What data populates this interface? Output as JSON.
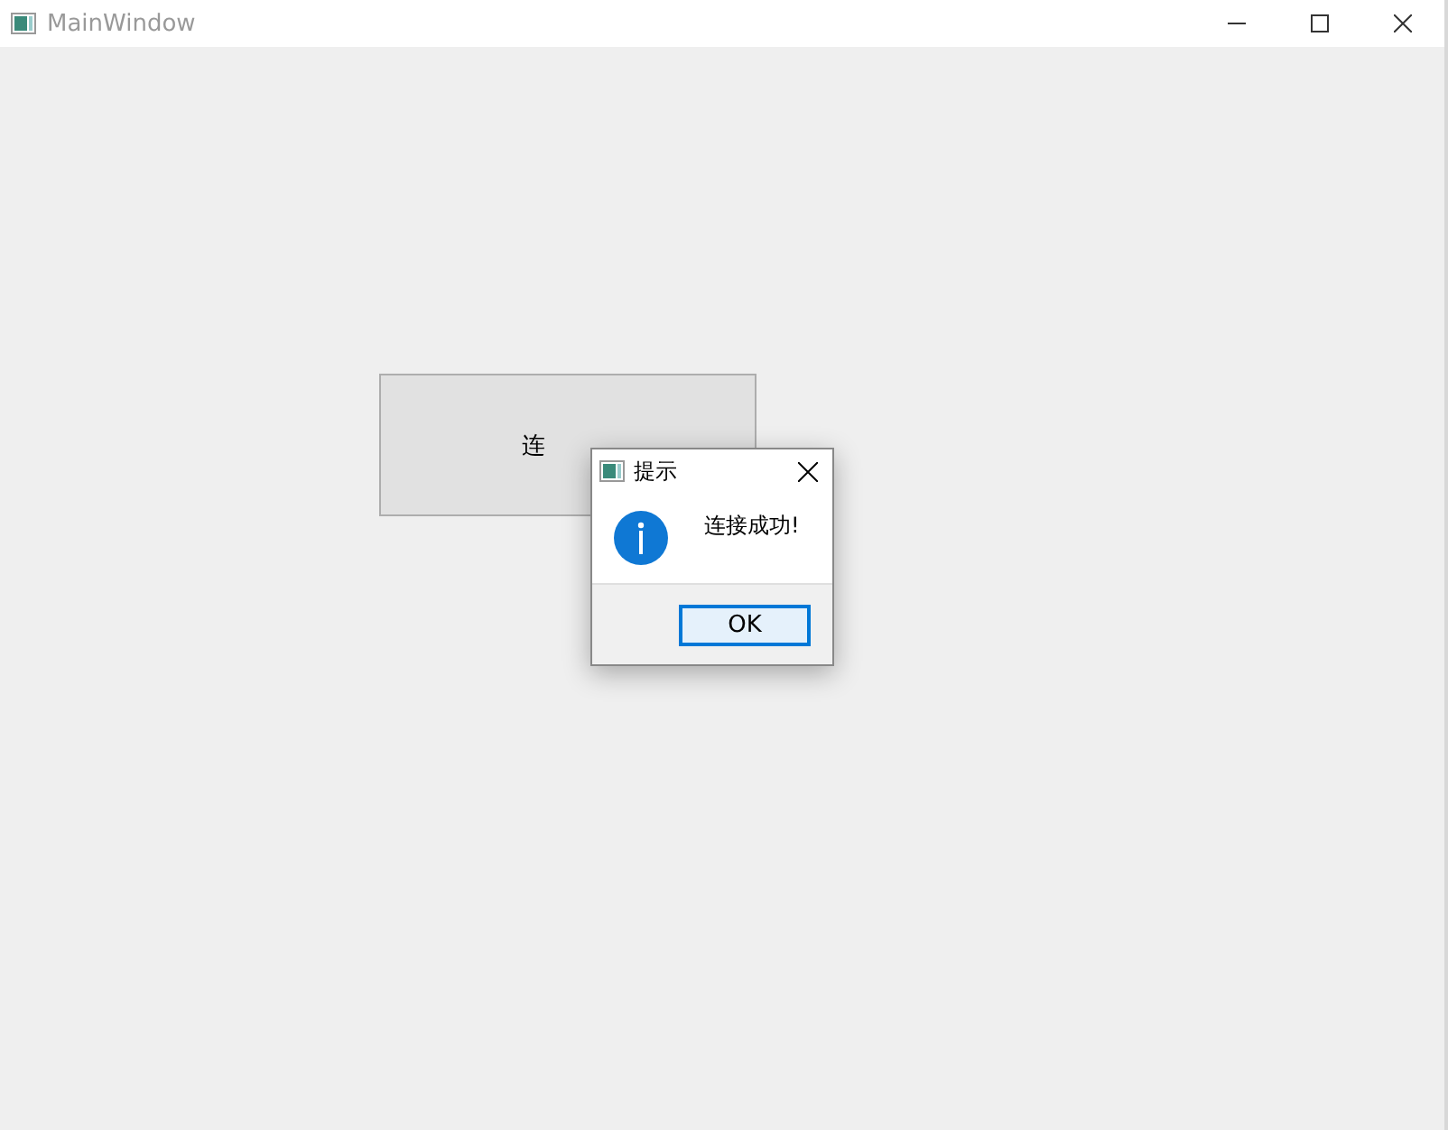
{
  "window": {
    "title": "MainWindow"
  },
  "connect_button": {
    "label": "连"
  },
  "dialog": {
    "title": "提示",
    "message": "连接成功!",
    "buttons": [
      {
        "label": "OK",
        "selected": true
      }
    ]
  }
}
